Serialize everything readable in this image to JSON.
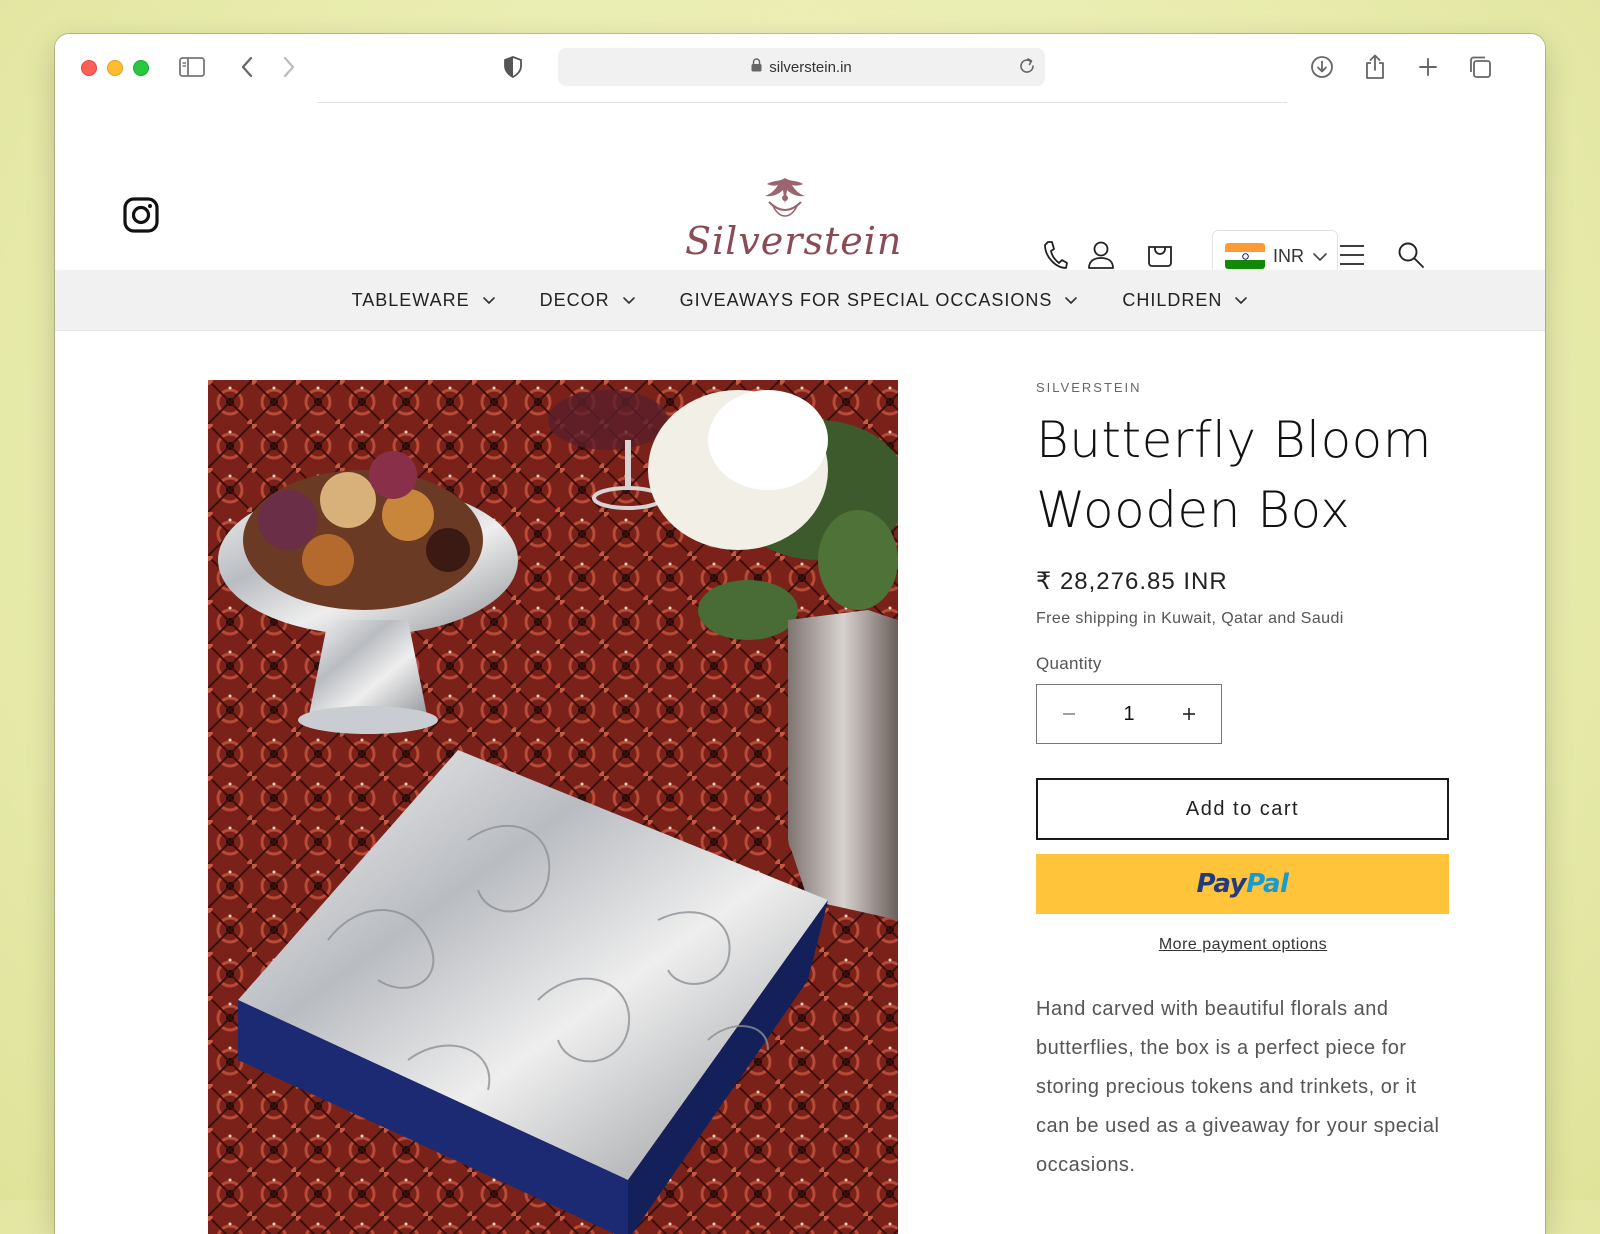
{
  "browser": {
    "url": "silverstein.in"
  },
  "header": {
    "logo_text": "Silverstein",
    "currency": "INR"
  },
  "nav": [
    {
      "label": "TABLEWARE"
    },
    {
      "label": "DECOR"
    },
    {
      "label": "GIVEAWAYS FOR SPECIAL OCCASIONS"
    },
    {
      "label": "CHILDREN"
    }
  ],
  "product": {
    "vendor": "SILVERSTEIN",
    "title_line1": "Butterfly Bloom",
    "title_line2": "Wooden Box",
    "price": "₹ 28,276.85 INR",
    "shipping": "Free shipping in Kuwait, Qatar and Saudi",
    "quantity_label": "Quantity",
    "quantity_value": "1",
    "add_to_cart": "Add to cart",
    "paypal_pay": "Pay",
    "paypal_pal": "Pal",
    "more_payment": "More payment options",
    "description": "Hand carved with beautiful florals and butterflies, the box is a perfect piece for storing precious tokens and trinkets, or it can be used as a giveaway for your special occasions."
  },
  "colors": {
    "paypal_yellow": "#ffc439",
    "logo_color": "#8a4b55",
    "background": "#eaedb0"
  },
  "icons": [
    "sidebar-icon",
    "back-icon",
    "forward-icon",
    "privacy-shield-icon",
    "lock-icon",
    "reload-icon",
    "download-icon",
    "share-icon",
    "new-tab-icon",
    "tabs-overview-icon",
    "instagram-icon",
    "phone-icon",
    "account-icon",
    "cart-icon",
    "india-flag-icon",
    "chevron-down-icon",
    "menu-icon",
    "search-icon",
    "minus-icon",
    "plus-icon"
  ]
}
